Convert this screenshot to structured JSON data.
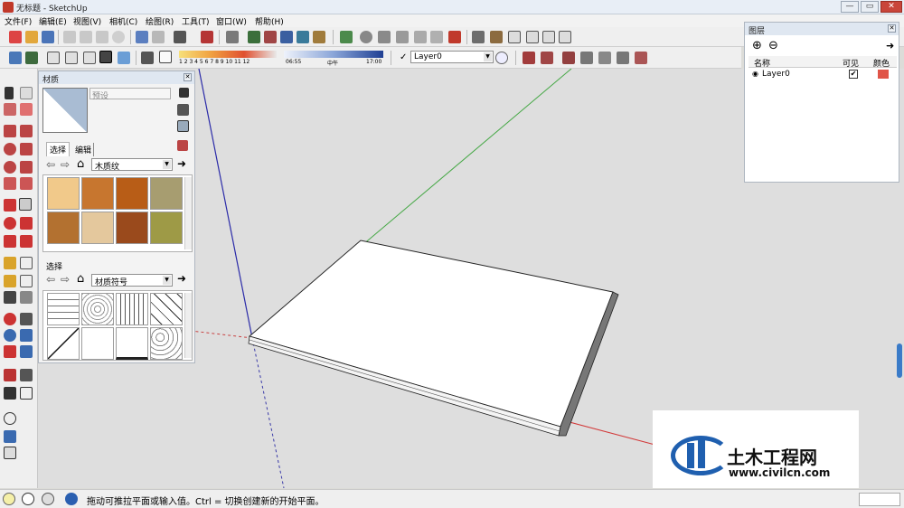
{
  "window": {
    "title": "无标题 - SketchUp",
    "buttons": {
      "minimize": "—",
      "restore": "▭",
      "close": "✕"
    }
  },
  "menu": [
    "文件(F)",
    "编辑(E)",
    "视图(V)",
    "相机(C)",
    "绘图(R)",
    "工具(T)",
    "窗口(W)",
    "帮助(H)"
  ],
  "shadow": {
    "month_ticks": "1 2 3 4 5 6 7 8 9 10 11 12",
    "time_start": "06:55",
    "time_mid": "中午",
    "time_end": "17:00"
  },
  "layer_select": {
    "check": "✓",
    "value": "Layer0"
  },
  "materials": {
    "title": "材质",
    "name_placeholder": "预设",
    "tabs": [
      "选择",
      "编辑"
    ],
    "library": "木质纹",
    "section2_label": "选择",
    "library2": "材质符号",
    "colors": {
      "swatch1": "#f1c98a",
      "swatch2": "#c7762f",
      "swatch3": "#b85d17",
      "swatch4": "#a79d70",
      "swatch5": "#b37130",
      "swatch6": "#e4c89d",
      "swatch7": "#9a4a1c",
      "swatch8": "#9e9a46"
    }
  },
  "layers": {
    "title": "图层",
    "headers": {
      "name": "名称",
      "visible": "可见",
      "color": "颜色"
    },
    "row": {
      "name": "Layer0",
      "visible": "✔",
      "color": "#e05548"
    }
  },
  "status": {
    "text": "拖动可推拉平面或输入值。Ctrl = 切换创建新的开始平面。"
  },
  "watermark": {
    "title": "土木工程网",
    "url": "www.civilcn.com"
  },
  "icons": {
    "app": "sketchup-app-icon",
    "home": "⌂",
    "back": "⇦",
    "forward": "⇨",
    "add": "⊕",
    "remove": "⊖",
    "export": "➜",
    "eyedropper": "dropper-icon",
    "radio": "◉"
  }
}
